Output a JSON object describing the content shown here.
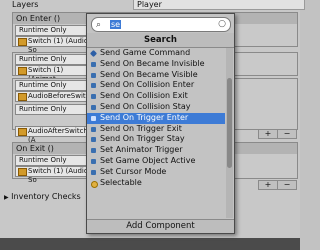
{
  "top": {
    "layers_label": "Layers",
    "player_value": "Player"
  },
  "events": [
    {
      "header": "On Enter ()",
      "dropdown": "Runtime Only",
      "object": "Switch (1) (Audio So"
    },
    {
      "header": "",
      "dropdown": "Runtime Only",
      "object": "Switch (1) (Animat"
    },
    {
      "header": "",
      "dropdown": "Runtime Only",
      "object": "AudioBeforeSwitch"
    },
    {
      "header": "",
      "dropdown": "Runtime Only",
      "object": "AudioAfterSwitch (A"
    },
    {
      "header": "On Exit ()",
      "dropdown": "Runtime Only",
      "object": "Switch (1) (Audio So"
    }
  ],
  "inventory_checks": "Inventory Checks",
  "popup": {
    "search_value": "se",
    "title": "Search",
    "items": [
      "Send Game Command",
      "Send On Became Invisible",
      "Send On Became Visible",
      "Send On Collision Enter",
      "Send On Collision Exit",
      "Send On Collision Stay",
      "Send On Trigger Enter",
      "Send On Trigger Exit",
      "Send On Trigger Stay",
      "Set Animator Trigger",
      "Set Game Object Active",
      "Set Cursor Mode",
      "Selectable"
    ],
    "selected_index": 6,
    "add_component": "Add Component"
  }
}
